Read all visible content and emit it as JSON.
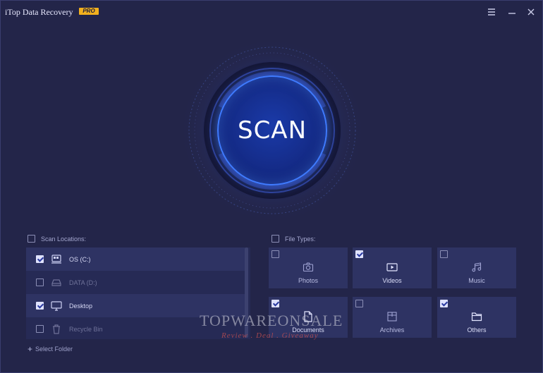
{
  "app": {
    "title": "iTop Data Recovery",
    "badge": "PRO"
  },
  "window_controls": {
    "menu_icon": "hamburger-menu-icon",
    "minimize_icon": "minimize-icon",
    "close_icon": "close-icon"
  },
  "scan": {
    "label": "SCAN",
    "accent": "#3f7bff"
  },
  "scan_locations": {
    "header": "Scan Locations:",
    "header_checked": false,
    "items": [
      {
        "label": "OS (C:)",
        "checked": true,
        "icon": "system-drive-icon",
        "enabled": true
      },
      {
        "label": "DATA (D:)",
        "checked": false,
        "icon": "drive-icon",
        "enabled": false
      },
      {
        "label": "Desktop",
        "checked": true,
        "icon": "monitor-icon",
        "enabled": true
      },
      {
        "label": "Recycle Bin",
        "checked": false,
        "icon": "trash-icon",
        "enabled": false
      }
    ],
    "select_folder": "Select Folder"
  },
  "file_types": {
    "header": "File Types:",
    "header_checked": false,
    "items": [
      {
        "label": "Photos",
        "checked": false,
        "icon": "camera-icon"
      },
      {
        "label": "Videos",
        "checked": true,
        "icon": "play-video-icon"
      },
      {
        "label": "Music",
        "checked": false,
        "icon": "music-note-icon"
      },
      {
        "label": "Documents",
        "checked": true,
        "icon": "document-icon"
      },
      {
        "label": "Archives",
        "checked": false,
        "icon": "archive-box-icon"
      },
      {
        "label": "Others",
        "checked": true,
        "icon": "folder-icon"
      }
    ]
  },
  "watermark": {
    "main": "TOPWAREONSALE",
    "sub": "Review . Deal . Giveaway"
  }
}
